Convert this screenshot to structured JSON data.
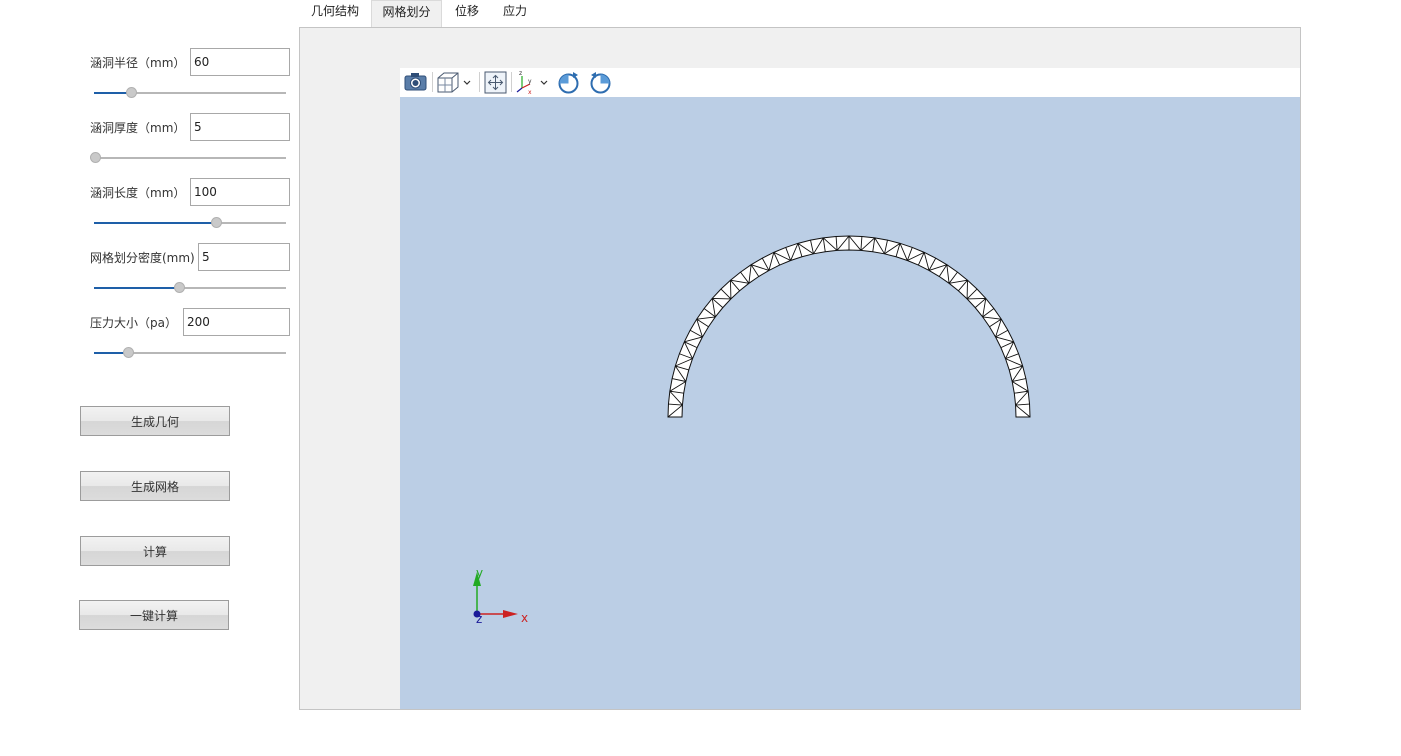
{
  "tabs": [
    {
      "label": "几何结构",
      "active": false
    },
    {
      "label": "网格划分",
      "active": true
    },
    {
      "label": "位移",
      "active": false
    },
    {
      "label": "应力",
      "active": false
    }
  ],
  "params": [
    {
      "label": "涵洞半径（mm）",
      "value": "60",
      "slider_fraction": 0.19
    },
    {
      "label": "涵洞厚度（mm）",
      "value": "5",
      "slider_fraction": 0.0
    },
    {
      "label": "涵洞长度（mm）",
      "value": "100",
      "slider_fraction": 0.64
    },
    {
      "label": "网格划分密度(mm)",
      "value": "5",
      "slider_fraction": 0.45
    },
    {
      "label": "压力大小（pa）",
      "value": "200",
      "slider_fraction": 0.18
    }
  ],
  "buttons": {
    "generate_geometry": "生成几何",
    "generate_mesh": "生成网格",
    "compute": "计算",
    "one_click_compute": "一键计算"
  },
  "toolbar": {
    "icons": [
      "camera-icon",
      "cube-view-icon",
      "fit-view-icon",
      "axes-icon",
      "rotate-cw-icon",
      "rotate-ccw-icon"
    ]
  },
  "axes": {
    "x": "x",
    "y": "y",
    "z": "z"
  },
  "colors": {
    "viewport_bg": "#bbcee5",
    "accent": "#1e5fa8",
    "axis_x": "#cc2222",
    "axis_y": "#22aa22",
    "axis_z": "#1a1a99"
  }
}
